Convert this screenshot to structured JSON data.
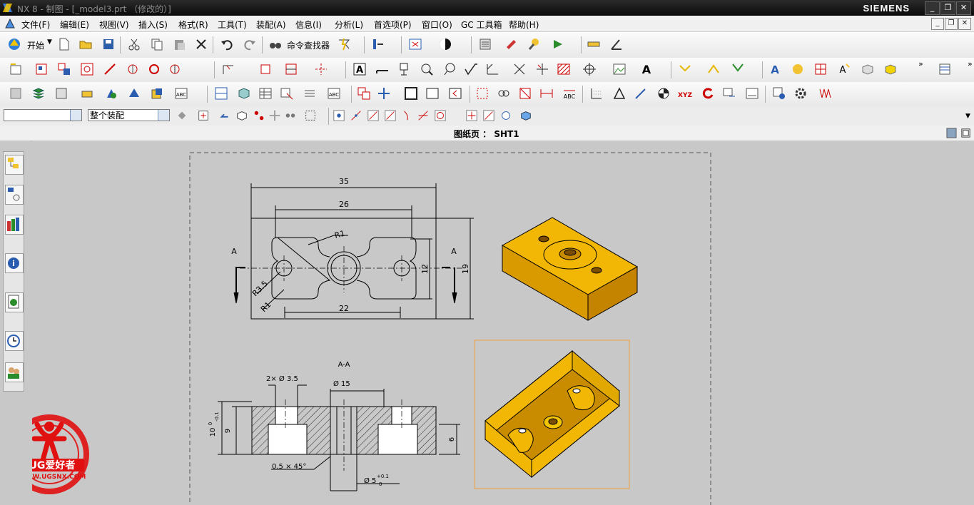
{
  "window": {
    "title": "NX 8 - 制图 - [_model3.prt （修改的）]",
    "brand": "SIEMENS"
  },
  "menu": [
    "文件(F)",
    "编辑(E)",
    "视图(V)",
    "插入(S)",
    "格式(R)",
    "工具(T)",
    "装配(A)",
    "信息(I)",
    "分析(L)",
    "首选项(P)",
    "窗口(O)",
    "GC 工具箱",
    "帮助(H)"
  ],
  "toolbar": {
    "start_label": "开始",
    "command_finder_label": "命令查找器"
  },
  "selection_bar": {
    "filter_value": "",
    "scope_value": "整个装配"
  },
  "sheet": {
    "label": "图纸页 ： SHT1"
  },
  "drawing": {
    "dims_top": [
      "35",
      "26",
      "R1",
      "12",
      "19",
      "22",
      "R3.5",
      "R1",
      "A",
      "A"
    ],
    "section_title": "A-A",
    "dims_section": [
      "2× Ø 3.5",
      "Ø 15",
      "9",
      "6",
      "0.5 × 45°",
      "Ø 5"
    ],
    "tol_10": "10",
    "tol_sup": "0",
    "tol_sub": "-0.1",
    "tol_5_sup": "+0.1",
    "tol_5_sub": "0"
  },
  "watermark": {
    "brand": "UG爱好者",
    "url": "WWW.UGSNX.COM"
  },
  "colors": {
    "part": "#f2b705",
    "part_dark": "#c98c00",
    "highlight": "#f0a040"
  }
}
